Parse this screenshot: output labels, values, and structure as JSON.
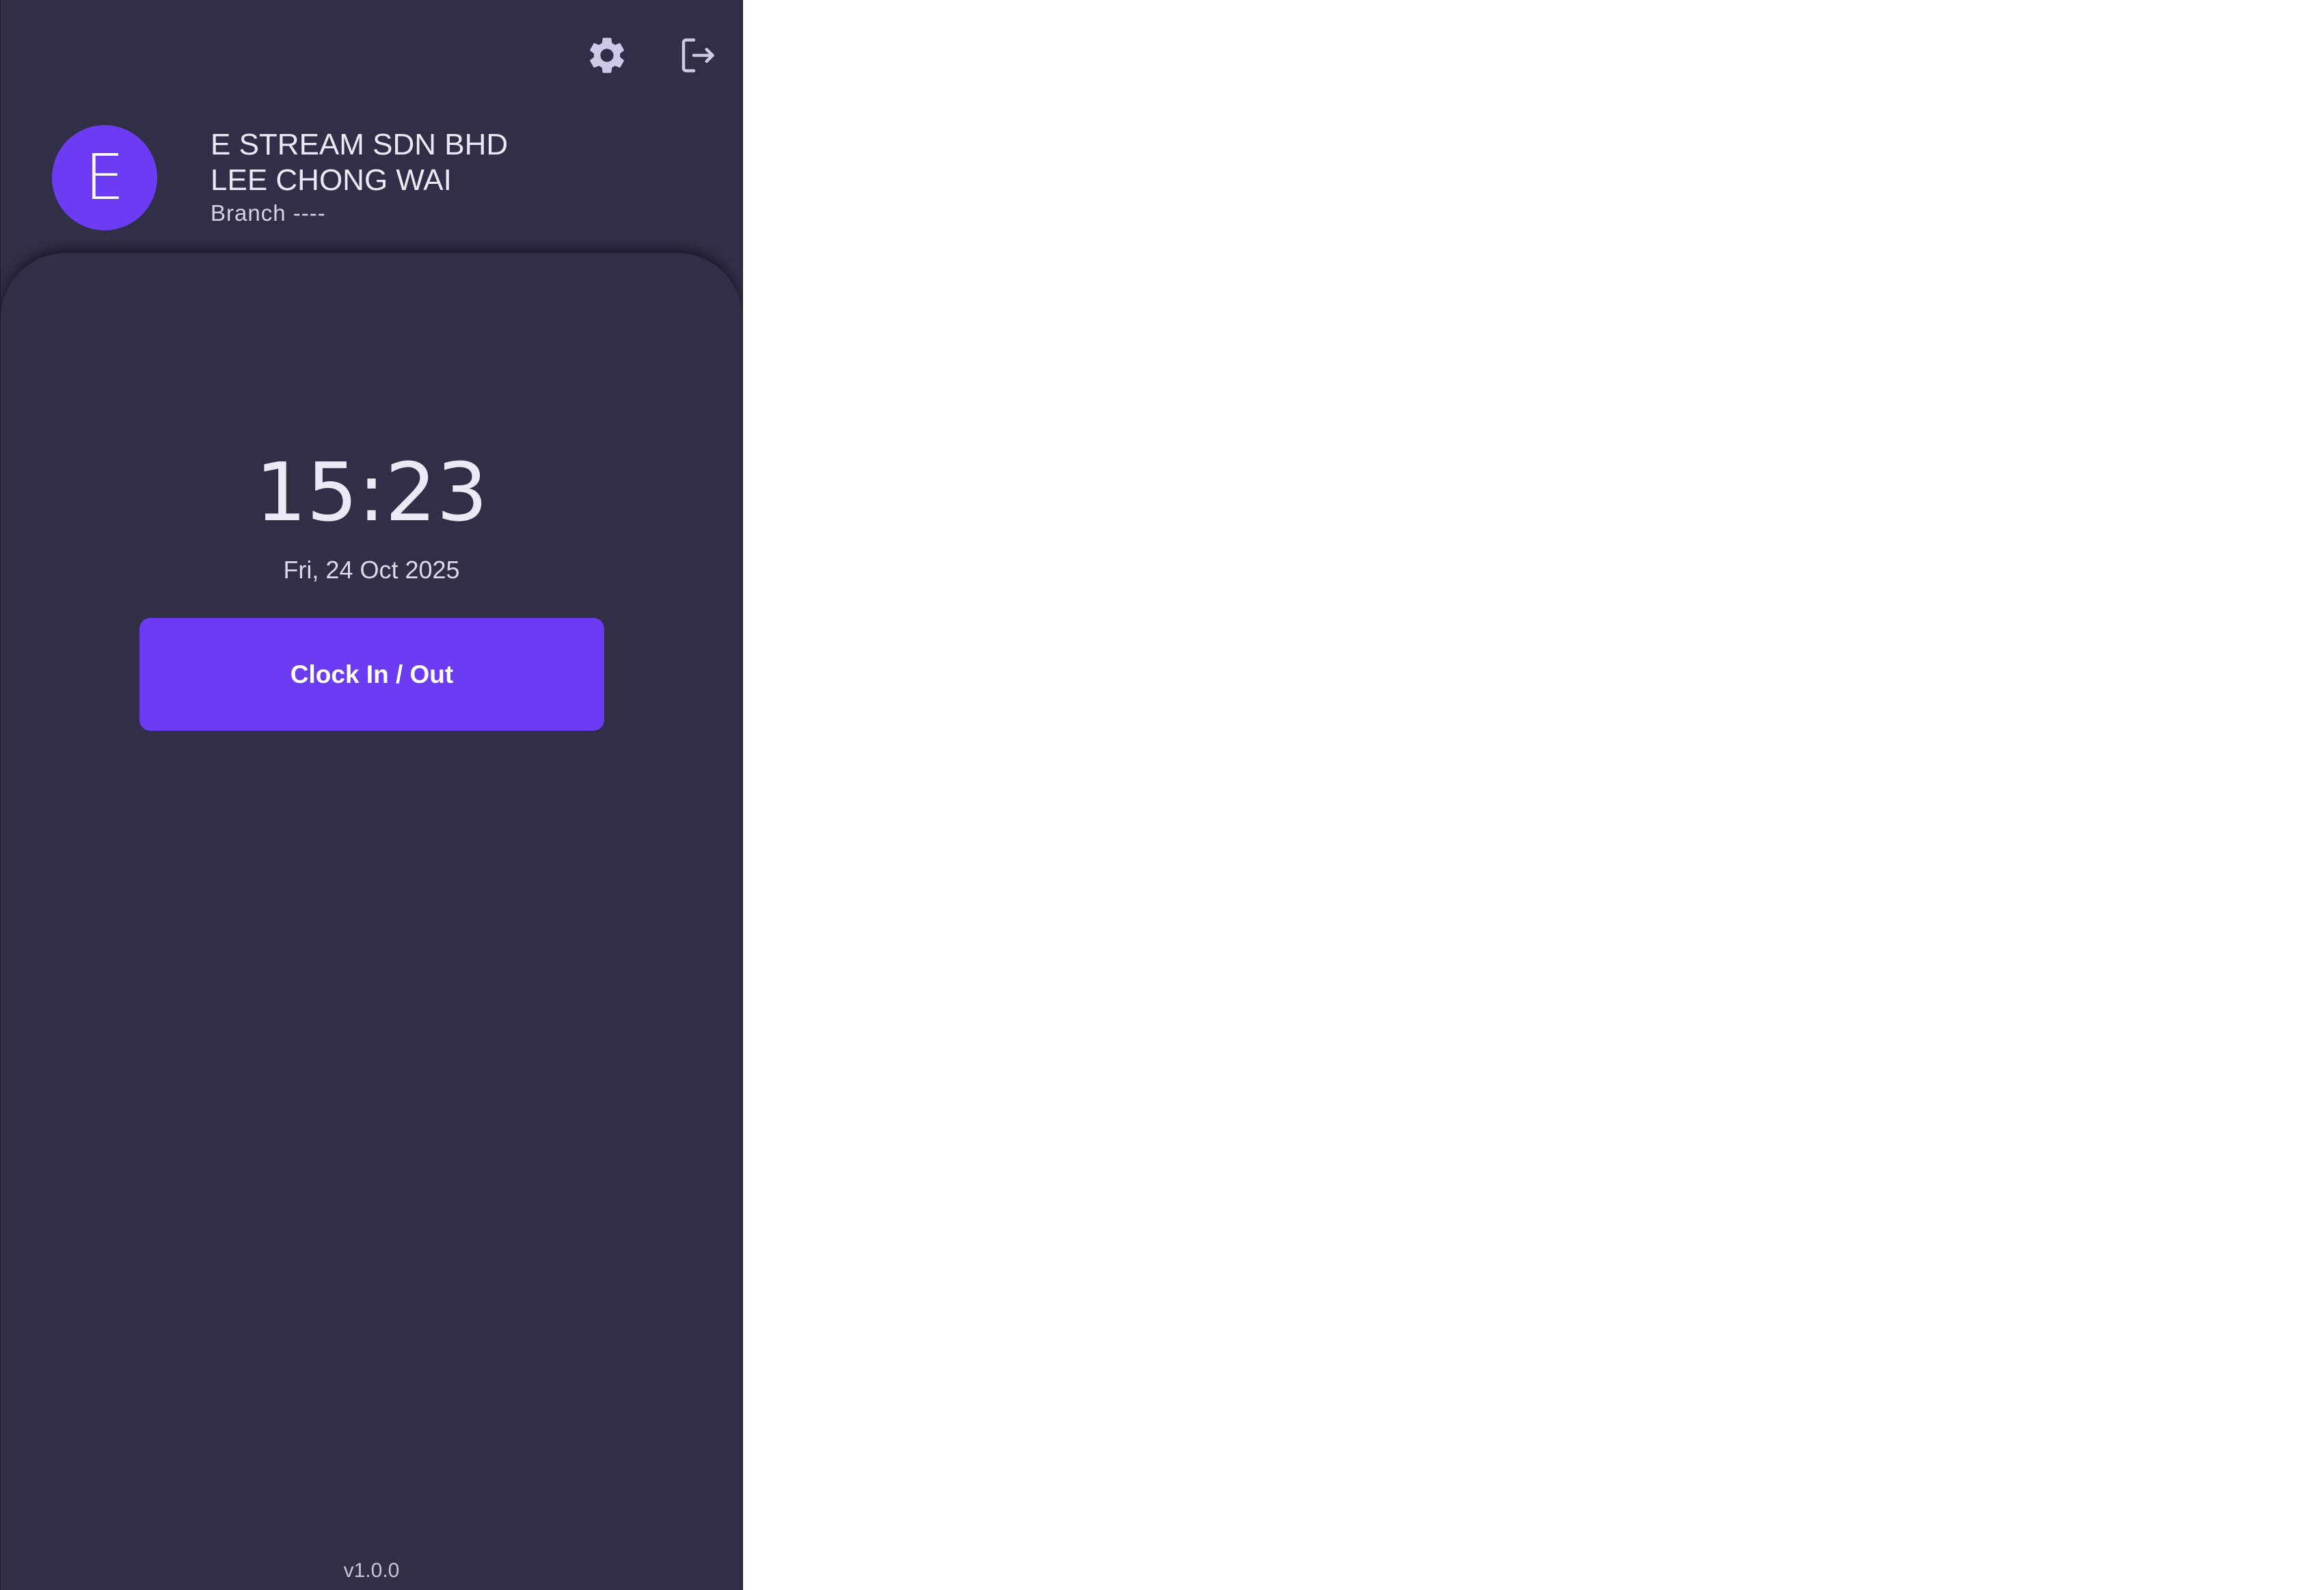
{
  "header": {
    "settings_icon": "gear-icon",
    "logout_icon": "logout-icon",
    "avatar_letter": "E",
    "company": "E STREAM SDN BHD",
    "user_name": "LEE CHONG WAI",
    "branch": "Branch ----"
  },
  "clock": {
    "time": "15:23",
    "date": "Fri, 24 Oct 2025",
    "button_label": "Clock In / Out"
  },
  "footer": {
    "version": "v1.0.0"
  },
  "colors": {
    "background": "#312e47",
    "accent": "#6c3cf5",
    "text": "#ece8f5",
    "icon": "#cfc8e6"
  }
}
